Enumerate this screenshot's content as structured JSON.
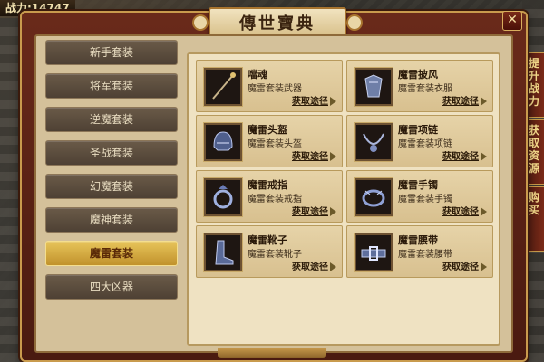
{
  "hud": {
    "score": "战力:14747"
  },
  "side_tabs": [
    {
      "label": "提升战力"
    },
    {
      "label": "获取资源"
    },
    {
      "label": "购买"
    }
  ],
  "window": {
    "title": "傳世寶典",
    "close_label": "✕"
  },
  "menu": [
    {
      "label": "新手套装",
      "active": false
    },
    {
      "label": "将军套装",
      "active": false
    },
    {
      "label": "逆魔套装",
      "active": false
    },
    {
      "label": "圣战套装",
      "active": false
    },
    {
      "label": "幻魔套装",
      "active": false
    },
    {
      "label": "魔神套装",
      "active": false
    },
    {
      "label": "魔雷套装",
      "active": true
    },
    {
      "label": "四大凶器",
      "active": false
    }
  ],
  "items": [
    {
      "name": "噹魂",
      "sub": "魔雷套装武器",
      "route": "获取途径",
      "icon": "staff-icon"
    },
    {
      "name": "魔雷披风",
      "sub": "魔雷套装衣服",
      "route": "获取途径",
      "icon": "armor-icon"
    },
    {
      "name": "魔雷头盔",
      "sub": "魔雷套装头盔",
      "route": "获取途径",
      "icon": "helmet-icon"
    },
    {
      "name": "魔雷项链",
      "sub": "魔雷套装项链",
      "route": "获取途径",
      "icon": "necklace-icon"
    },
    {
      "name": "魔雷戒指",
      "sub": "魔雷套装戒指",
      "route": "获取途径",
      "icon": "ring-icon"
    },
    {
      "name": "魔雷手镯",
      "sub": "魔雷套装手镯",
      "route": "获取途径",
      "icon": "bracelet-icon"
    },
    {
      "name": "魔雷靴子",
      "sub": "魔雷套装靴子",
      "route": "获取途径",
      "icon": "boots-icon"
    },
    {
      "name": "魔雷腰带",
      "sub": "魔雷套装腰带",
      "route": "获取途径",
      "icon": "belt-icon"
    }
  ],
  "colors": {
    "active_tab": "#e7c45a",
    "panel": "#efe2c2",
    "frame": "#c99b4d"
  }
}
